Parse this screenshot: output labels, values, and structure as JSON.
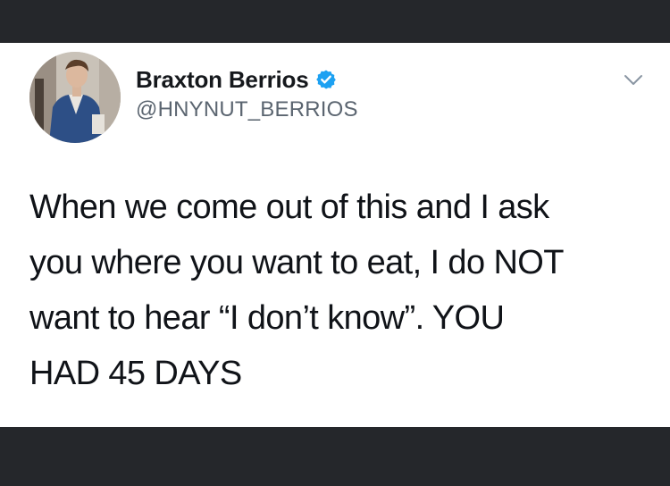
{
  "tweet": {
    "author_name": "Braxton Berrios",
    "author_handle": "@HNYNUT_BERRIOS",
    "verified": true,
    "text_lines": [
      "When we come out of this and I ask",
      "you where you want to eat, I do NOT",
      "want to hear “I don’t know”. YOU",
      "HAD 45 DAYS"
    ]
  },
  "icons": {
    "verified": "verified-badge-icon",
    "menu": "chevron-down-icon"
  },
  "colors": {
    "background_bar": "#25272b",
    "card": "#ffffff",
    "verified_blue": "#1da1f2",
    "handle_gray": "#5b6570"
  }
}
